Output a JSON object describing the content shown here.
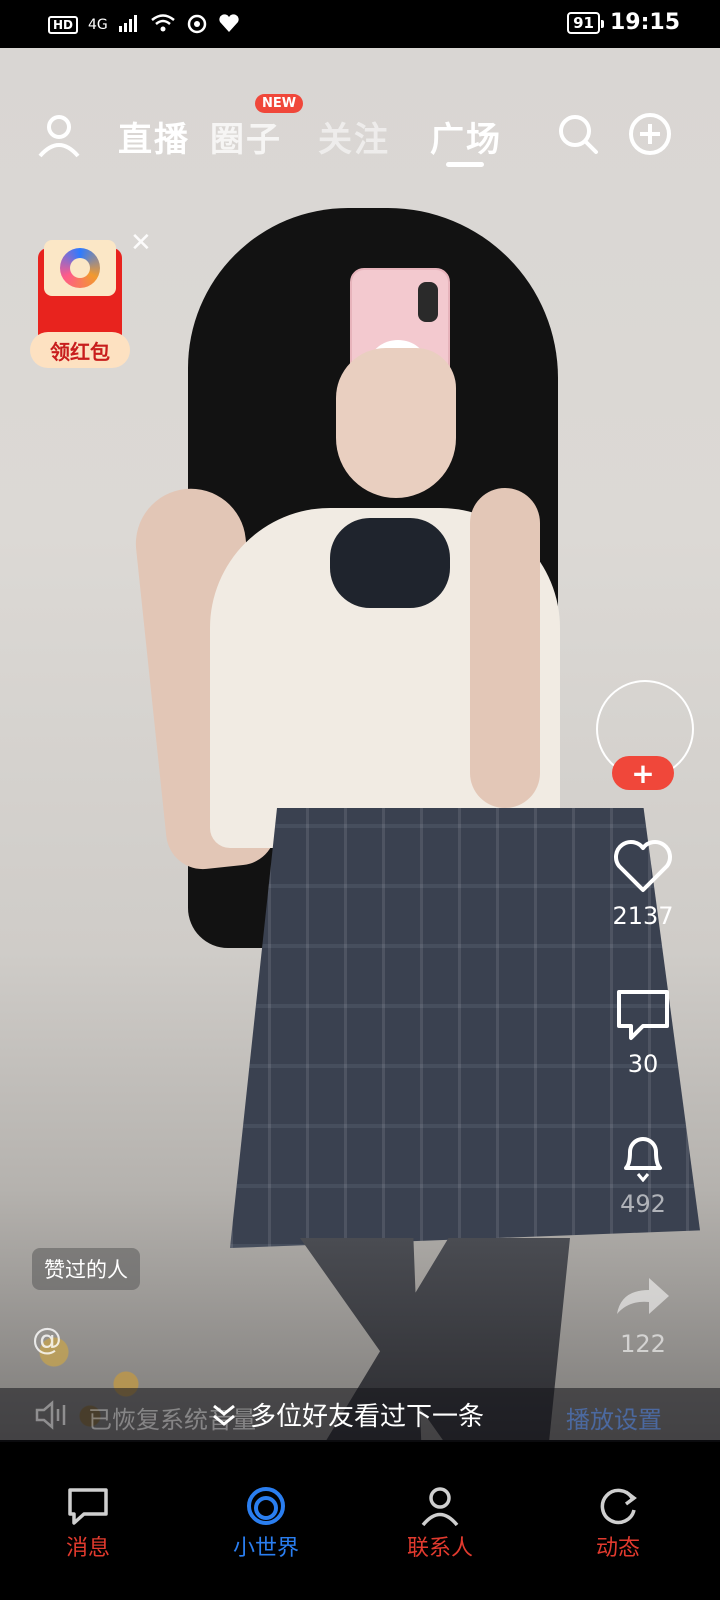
{
  "status_bar": {
    "hd": "HD",
    "network": "4G",
    "battery": "91",
    "time": "19:15"
  },
  "nav": {
    "tabs": [
      {
        "label": "直播"
      },
      {
        "label": "圈子",
        "badge": "NEW"
      },
      {
        "label": "关注"
      },
      {
        "label": "广场"
      }
    ],
    "active_tab": "广场"
  },
  "red_packet": {
    "label": "领红包"
  },
  "actions": {
    "follow_plus": "+",
    "likes": "2137",
    "comments": "30",
    "notify": "492",
    "shares": "122"
  },
  "overlay": {
    "liked_people": "赞过的人",
    "at": "@",
    "volume_restored": "已恢复系统音量",
    "next_hint": "多位好友看过下一条",
    "play_settings": "播放设置"
  },
  "tabbar": {
    "items": [
      {
        "label": "消息"
      },
      {
        "label": "小世界"
      },
      {
        "label": "联系人"
      },
      {
        "label": "动态"
      }
    ]
  },
  "colors": {
    "accent_red": "#f0473a",
    "active_blue": "#2a7ef0"
  }
}
